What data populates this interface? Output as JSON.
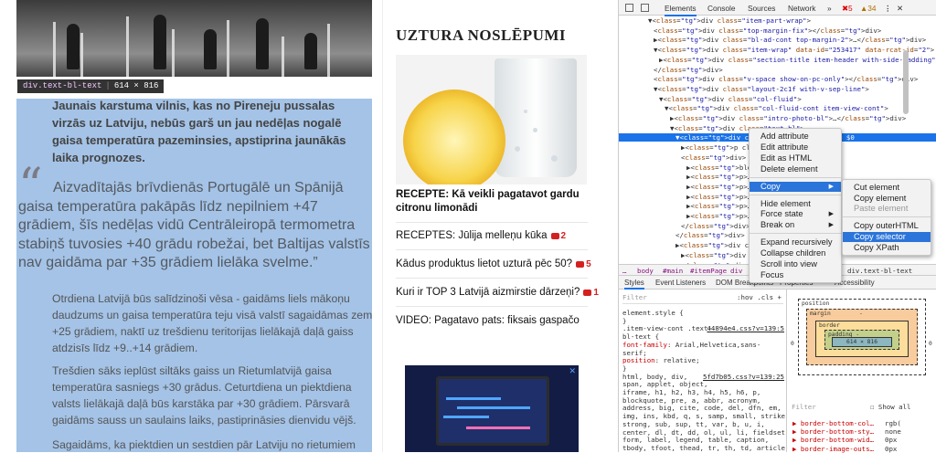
{
  "article": {
    "tooltip_tag": "div.text-bl-text",
    "tooltip_size": "614 × 816",
    "lead": "Jaunais karstuma vilnis, kas no Pireneju pussalas virzās uz Latviju, nebūs garš un jau nedēļas nogalē gaisa temperatūra pazeminsies, apstiprina jaunākās laika prognozes.",
    "quote_mark": "“",
    "quote": "Aizvadītajās brīvdienās Portugālē un Spānijā gaisa temperatūra pakāpās līdz nepilniem +47 grādiem, šīs nedēļas vidū Centrāleiropā termometra stabiņš tuvosies +40 grādu robežai, bet Baltijas valstīs nav gaidāma par +35 grādiem lielāka svelme.”",
    "p1": "Otrdiena Latvijā būs salīdzinoši vēsa - gaidāms liels mākoņu daudzums un gaisa temperatūra teju visā valstī sagaidāmas zem +25 grādiem, naktī uz trešdienu teritorijas lielākajā daļā gaiss atdzisīs līdz +9..+14 grādiem.",
    "p2": "Trešdien sāks ieplūst siltāks gaiss un Rietumlatvijā gaisa temperatūra sasniegs +30 grādus. Ceturtdiena un piektdiena valsts lielākajā daļā būs karstāka par +30 grādiem. Pārsvarā gaidāms sauss un saulains laiks, pastiprināsies dienvidu vējš.",
    "p3": "Sagaidāms, ka piektdien un sestdien pār Latviju no rietumiem nāks"
  },
  "sidebar": {
    "title": "UZTURA NOSLĒPUMI",
    "recipe": "RECEPTE: Kā veikli pagatavot gardu citronu limonādi",
    "links": [
      {
        "text": "RECEPTES: Jūlija melleņu kūka",
        "count": "2"
      },
      {
        "text": "Kādus produktus lietot uzturā pēc 50?",
        "count": "5"
      },
      {
        "text": "Kuri ir TOP 3 Latvijā aizmirstie dārzeņi?",
        "count": "1"
      },
      {
        "text": "VIDEO: Pagatavo pats: fiksais gaspačo",
        "count": ""
      }
    ],
    "ad_close": "✕"
  },
  "devtools": {
    "tabs": [
      "Elements",
      "Console",
      "Sources",
      "Network"
    ],
    "errors": "5",
    "warnings": "34",
    "dom_lines": [
      {
        "indent": 7,
        "text": "▼<div class=\"item-part-wrap\">"
      },
      {
        "indent": 8,
        "text": "<div class=\"top-margin-fix\"></div>"
      },
      {
        "indent": 8,
        "text": "▶<div class=\"bl-ad-cont top-margin-2\">…</div>"
      },
      {
        "indent": 8,
        "text": "▼<div class=\"item-wrap\" data-id=\"253417\" data-rcat-id=\"2\">"
      },
      {
        "indent": 9,
        "text": "▶<div class=\"section-title item-header with-side-padding\">…"
      },
      {
        "indent": 8,
        "text": "</div>"
      },
      {
        "indent": 8,
        "text": "<div class=\"v-space show-on-pc-only\"></div>"
      },
      {
        "indent": 8,
        "text": "▼<div class=\"layout-2c1f with-v-sep-line\">"
      },
      {
        "indent": 9,
        "text": "▼<div class=\"col-fluid\">"
      },
      {
        "indent": 10,
        "text": "▼<div class=\"col-fluid-cont item-view-cont\">"
      },
      {
        "indent": 11,
        "text": "▶<div class=\"intro-photo-bl\">…</div>"
      },
      {
        "indent": 11,
        "text": "▼<div class=\"text-bl\">"
      },
      {
        "indent": 12,
        "text": "▼<div class=\"text-bl-text\"> == $0"
      },
      {
        "indent": 13,
        "text": "▶<p class"
      },
      {
        "indent": 13,
        "text": "<div>"
      },
      {
        "indent": 14,
        "text": "▶<blockqu"
      },
      {
        "indent": 14,
        "text": "▶<p>…</p>"
      },
      {
        "indent": 14,
        "text": "▶<p>…</p>"
      },
      {
        "indent": 14,
        "text": "▶<p>…</p>"
      },
      {
        "indent": 14,
        "text": "▶<p>…</p>"
      },
      {
        "indent": 14,
        "text": "▶<p>…</p>"
      },
      {
        "indent": 13,
        "text": "</div>"
      },
      {
        "indent": 12,
        "text": "</div>"
      },
      {
        "indent": 12,
        "text": "▶<div class"
      },
      {
        "indent": 13,
        "text": "▶<div class"
      },
      {
        "indent": 13,
        "text": "</div>"
      },
      {
        "indent": 13,
        "text": "▶<div class"
      },
      {
        "indent": 13,
        "text": "▶<div class"
      },
      {
        "indent": 14,
        "text": "▶<hov"
      },
      {
        "indent": 13,
        "text": "<div cl"
      },
      {
        "indent": 13,
        "text": "</div>"
      }
    ],
    "breadcrumbs": [
      "…",
      "body",
      "#main",
      "#itemPage",
      "div",
      "div.text-bl-text"
    ],
    "subtabs": [
      "Styles",
      "Event Listeners",
      "DOM Breakpoints",
      "Properties",
      "Accessibility"
    ],
    "styles_filter": "Filter",
    "styles_toggles": ":hov  .cls  +",
    "style_rules": [
      {
        "text": "element.style {",
        "kind": "sel"
      },
      {
        "text": "}",
        "kind": "sel"
      },
      {
        "text": ".item-view-cont .text-",
        "kind": "sel",
        "link": "44894e4.css?v=139:5"
      },
      {
        "text": "bl-text {",
        "kind": "sel"
      },
      {
        "text": "  font-family: Arial,Helvetica,sans-",
        "kind": "prop"
      },
      {
        "text": "      serif;",
        "kind": "val"
      },
      {
        "text": "  position: relative;",
        "kind": "prop"
      },
      {
        "text": "}",
        "kind": "sel"
      },
      {
        "text": "html, body, div,",
        "kind": "sel",
        "link": "5fd7b05.css?v=139:25"
      },
      {
        "text": "span, applet, object,",
        "kind": "val"
      },
      {
        "text": "iframe, h1, h2, h3, h4, h5, h6, p,",
        "kind": "val"
      },
      {
        "text": "blockquote, pre, a, abbr, acronym,",
        "kind": "val"
      },
      {
        "text": "address, big, cite, code, del, dfn, em,",
        "kind": "val"
      },
      {
        "text": "img, ins, kbd, q, s, samp, small, strike,",
        "kind": "val"
      },
      {
        "text": "strong, sub, sup, tt, var, b, u, i,",
        "kind": "val"
      },
      {
        "text": "center, dl, dt, dd, ol, ul, li, fieldset,",
        "kind": "val"
      },
      {
        "text": "form, label, legend, table, caption,",
        "kind": "val"
      },
      {
        "text": "tbody, tfoot, thead, tr, th, td, article,",
        "kind": "val"
      }
    ],
    "box": {
      "position": "position",
      "margin": "margin",
      "border": "border",
      "padding": "padding -",
      "content": "614 × 816",
      "zero": "0",
      "dash": "-"
    },
    "computed_filter": "Filter",
    "show_all": "Show all",
    "computed": [
      {
        "prop": "▶ border-bottom-col…",
        "val": "rgb("
      },
      {
        "prop": "▶ border-bottom-sty…",
        "val": "none"
      },
      {
        "prop": "▶ border-bottom-wid…",
        "val": "0px"
      },
      {
        "prop": "▶ border-image-outs…",
        "val": "0px"
      }
    ],
    "context_menu": [
      {
        "label": "Add attribute"
      },
      {
        "label": "Edit attribute"
      },
      {
        "label": "Edit as HTML"
      },
      {
        "label": "Delete element"
      },
      {
        "label": "Copy",
        "arrow": "▶",
        "highlight": true,
        "sep_before": true
      },
      {
        "label": "Hide element",
        "sep_before": true
      },
      {
        "label": "Force state",
        "arrow": "▶"
      },
      {
        "label": "Break on",
        "arrow": "▶"
      },
      {
        "label": "Expand recursively",
        "sep_before": true
      },
      {
        "label": "Collapse children"
      },
      {
        "label": "Scroll into view"
      },
      {
        "label": "Focus"
      }
    ],
    "copy_submenu": [
      {
        "label": "Cut element"
      },
      {
        "label": "Copy element"
      },
      {
        "label": "Paste element",
        "disabled": true
      },
      {
        "label": "Copy outerHTML",
        "sep_before": true
      },
      {
        "label": "Copy selector",
        "highlight": true
      },
      {
        "label": "Copy XPath"
      }
    ]
  }
}
